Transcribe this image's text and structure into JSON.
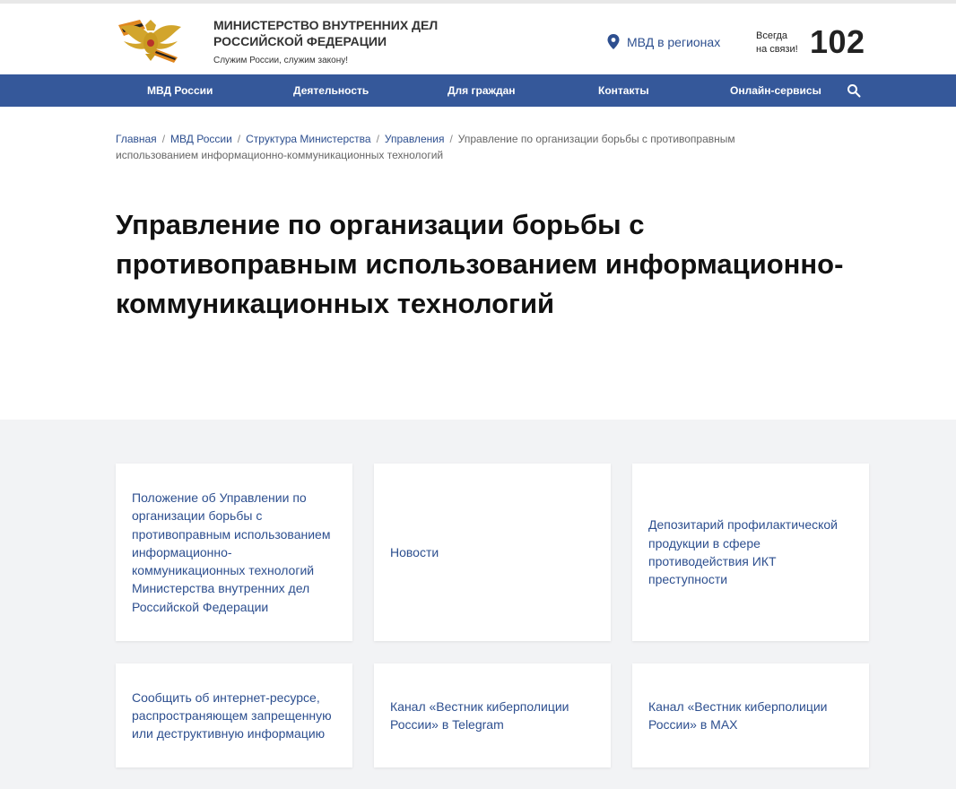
{
  "header": {
    "org_title": "МИНИСТЕРСТВО ВНУТРЕННИХ ДЕЛ РОССИЙСКОЙ ФЕДЕРАЦИИ",
    "motto": "Служим России, служим закону!",
    "regions_label": "МВД в регионах",
    "always_line1": "Всегда",
    "always_line2": "на связи!",
    "phone": "102",
    "icons": [
      "emblem-icon",
      "location-pin-icon",
      "search-icon"
    ]
  },
  "nav": {
    "items": [
      {
        "label": "МВД России"
      },
      {
        "label": "Деятельность"
      },
      {
        "label": "Для граждан"
      },
      {
        "label": "Контакты"
      },
      {
        "label": "Онлайн-сервисы"
      }
    ]
  },
  "breadcrumb": {
    "links": [
      "Главная",
      "МВД России",
      "Структура Министерства",
      "Управления"
    ],
    "separator": "/",
    "current": "Управление по организации борьбы с противоправным использованием информационно-коммуникационных технологий"
  },
  "page": {
    "title": "Управление по организации борьбы с противоправным использованием информационно-коммуникационных технологий"
  },
  "cards": [
    {
      "label": "Положение об Управлении по организации борьбы с противоправным использованием информационно-коммуникационных технологий Министерства внутренних дел Российской Федерации"
    },
    {
      "label": "Новости"
    },
    {
      "label": "Депозитарий профилактической продукции в сфере противодействия ИКТ преступности"
    },
    {
      "label": "Сообщить об интернет-ресурсе, распространяющем запрещенную или деструктивную информацию"
    },
    {
      "label": "Канал «Вестник киберполиции России» в Telegram"
    },
    {
      "label": "Канал «Вестник киберполиции России» в MAX"
    }
  ],
  "colors": {
    "nav_bg": "#35589a",
    "link": "#2d4f8f",
    "cards_bg": "#f2f3f5"
  }
}
